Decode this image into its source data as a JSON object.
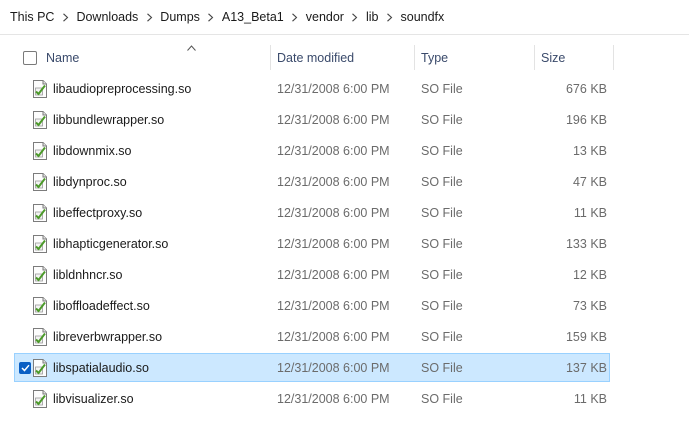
{
  "breadcrumb": {
    "items": [
      "This PC",
      "Downloads",
      "Dumps",
      "A13_Beta1",
      "vendor",
      "lib",
      "soundfx"
    ]
  },
  "columns": {
    "name": "Name",
    "date": "Date modified",
    "type": "Type",
    "size": "Size"
  },
  "files": [
    {
      "name": "libaudiopreprocessing.so",
      "date": "12/31/2008 6:00 PM",
      "type": "SO File",
      "size": "676 KB",
      "selected": false
    },
    {
      "name": "libbundlewrapper.so",
      "date": "12/31/2008 6:00 PM",
      "type": "SO File",
      "size": "196 KB",
      "selected": false
    },
    {
      "name": "libdownmix.so",
      "date": "12/31/2008 6:00 PM",
      "type": "SO File",
      "size": "13 KB",
      "selected": false
    },
    {
      "name": "libdynproc.so",
      "date": "12/31/2008 6:00 PM",
      "type": "SO File",
      "size": "47 KB",
      "selected": false
    },
    {
      "name": "libeffectproxy.so",
      "date": "12/31/2008 6:00 PM",
      "type": "SO File",
      "size": "11 KB",
      "selected": false
    },
    {
      "name": "libhapticgenerator.so",
      "date": "12/31/2008 6:00 PM",
      "type": "SO File",
      "size": "133 KB",
      "selected": false
    },
    {
      "name": "libldnhncr.so",
      "date": "12/31/2008 6:00 PM",
      "type": "SO File",
      "size": "12 KB",
      "selected": false
    },
    {
      "name": "liboffloadeffect.so",
      "date": "12/31/2008 6:00 PM",
      "type": "SO File",
      "size": "73 KB",
      "selected": false
    },
    {
      "name": "libreverbwrapper.so",
      "date": "12/31/2008 6:00 PM",
      "type": "SO File",
      "size": "159 KB",
      "selected": false
    },
    {
      "name": "libspatialaudio.so",
      "date": "12/31/2008 6:00 PM",
      "type": "SO File",
      "size": "137 KB",
      "selected": true
    },
    {
      "name": "libvisualizer.so",
      "date": "12/31/2008 6:00 PM",
      "type": "SO File",
      "size": "11 KB",
      "selected": false
    }
  ],
  "colors": {
    "selection_bg": "#cce8ff",
    "selection_border": "#99d1ff",
    "header_text": "#3a4a6b"
  }
}
